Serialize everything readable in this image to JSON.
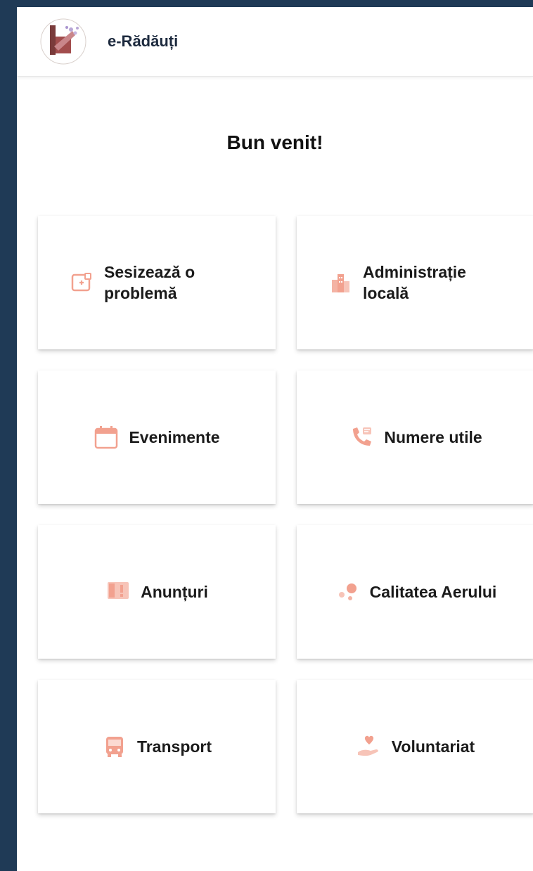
{
  "app": {
    "title": "e-Rădăuți"
  },
  "main": {
    "welcome": "Bun venit!"
  },
  "tiles": [
    {
      "label": "Sesizează o problemă",
      "icon": "report-problem-icon"
    },
    {
      "label": "Administrație locală",
      "icon": "city-buildings-icon"
    },
    {
      "label": "Evenimente",
      "icon": "calendar-icon"
    },
    {
      "label": "Numere utile",
      "icon": "phone-call-icon"
    },
    {
      "label": "Anunțuri",
      "icon": "announcement-icon"
    },
    {
      "label": "Calitatea Aerului",
      "icon": "air-quality-icon"
    },
    {
      "label": "Transport",
      "icon": "bus-icon"
    },
    {
      "label": "Voluntariat",
      "icon": "heart-hand-icon"
    }
  ],
  "colors": {
    "accent": "#f2a18f",
    "frame": "#1f3a56",
    "title": "#1d2a3e"
  }
}
